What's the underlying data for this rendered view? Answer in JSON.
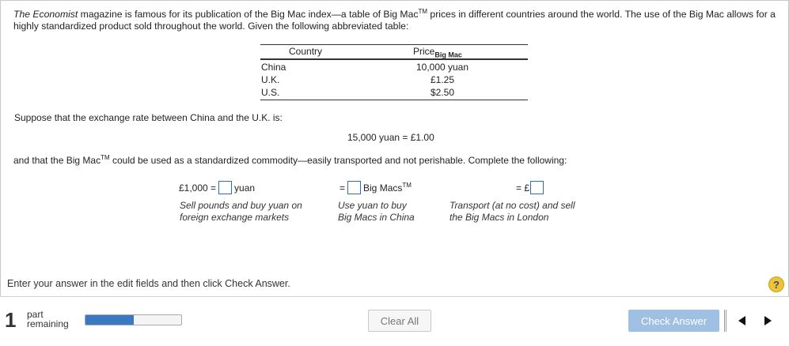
{
  "intro": {
    "magazine": "The Economist",
    "part1": " magazine is famous for its publication of the Big Mac index—a table of Big Mac",
    "tm": "TM",
    "part2": " prices in different countries around the world. The use of the Big Mac allows for a highly standardized product sold throughout the world. Given the following abbreviated table:"
  },
  "table": {
    "col_country": "Country",
    "col_price": "Price",
    "col_price_sub": "Big Mac",
    "rows": [
      {
        "country": "China",
        "price": "10,000 yuan"
      },
      {
        "country": "U.K.",
        "price": "£1.25"
      },
      {
        "country": "U.S.",
        "price": "$2.50"
      }
    ]
  },
  "exchange_intro": "Suppose that the exchange rate between China and the U.K. is:",
  "exchange_rate": "15,000 yuan = £1.00",
  "commodity_text": {
    "part1": "and that the Big Mac",
    "tm": "TM",
    "part2": " could be used as a standardized commodity—easily transported and not perishable. Complete the following:"
  },
  "equation": {
    "lhs": "£1,000 =",
    "unit1": "yuan",
    "eq2": "=",
    "unit2": "Big Macs",
    "tm": "TM",
    "eq3": "= £",
    "note1": [
      "Sell pounds and buy yuan on",
      "foreign exchange markets"
    ],
    "note2": [
      "Use yuan to buy",
      "Big Macs in China"
    ],
    "note3": [
      "Transport (at no cost) and sell",
      "the Big Macs in London"
    ]
  },
  "instructions": "Enter your answer in the edit fields and then click Check Answer.",
  "help_label": "?",
  "footer": {
    "parts_count": "1",
    "parts_word": "part",
    "remaining_word": "remaining",
    "progress_fraction": 0.5,
    "clear_label": "Clear All",
    "check_label": "Check Answer",
    "prev_icon": "triangle-left-icon",
    "next_icon": "triangle-right-icon"
  },
  "colors": {
    "accent": "#3a78c2",
    "check_button": "#9fbfe3",
    "help": "#f0c330"
  }
}
